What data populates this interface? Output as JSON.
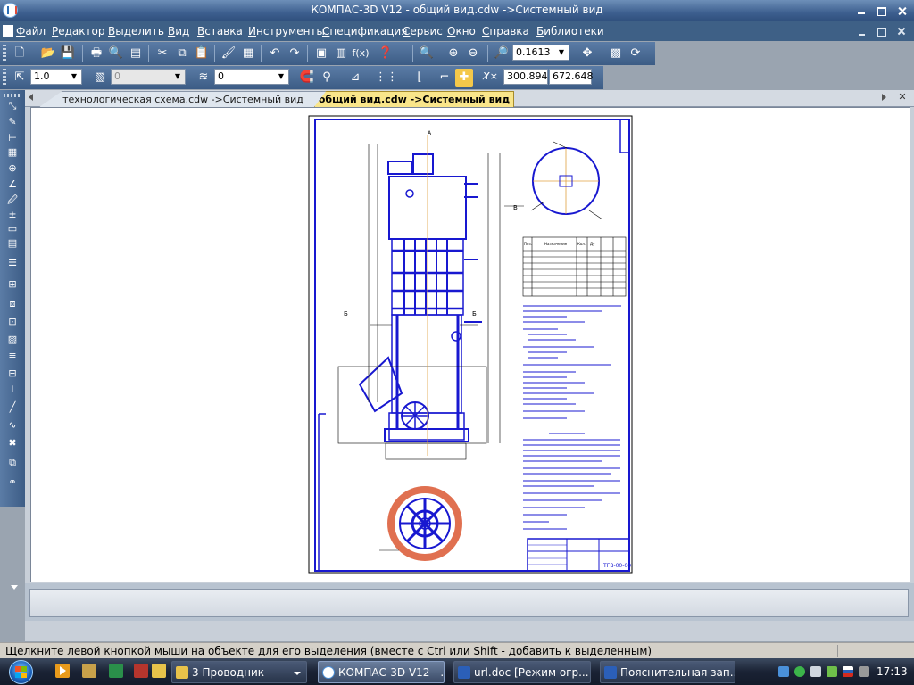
{
  "window": {
    "title": "КОМПАС-3D V12 - общий вид.cdw ->Системный вид"
  },
  "menu": [
    "Файл",
    "Редактор",
    "Выделить",
    "Вид",
    "Вставка",
    "Инструменты",
    "Спецификация",
    "Сервис",
    "Окно",
    "Справка",
    "Библиотеки"
  ],
  "toolbar1": {
    "zoom_value": "0.1613"
  },
  "toolbar2": {
    "line_scale": "1.0",
    "style_value": "0",
    "layer_value": "0",
    "coord_x": "300.894",
    "coord_y": "672.648"
  },
  "tabs": [
    {
      "label": "технологическая схема.cdw ->Системный вид",
      "active": false
    },
    {
      "label": "общий вид.cdw ->Системный вид",
      "active": true
    }
  ],
  "drawing": {
    "table_header": {
      "pos": "Поз.",
      "name": "Назначение",
      "count": "Кол.",
      "dia": "Ду"
    },
    "stamp_code": "ТГВ-00-00",
    "view_label_b": "В",
    "view_label_b2": "Б",
    "section_label": "А"
  },
  "status": {
    "hint": "Щелкните левой кнопкой мыши на объекте для его выделения (вместе с Ctrl или Shift - добавить к выделенным)"
  },
  "taskbar": {
    "items": [
      {
        "label": "3 Проводник",
        "active": false
      },
      {
        "label": "КОМПАС-3D V12 - ...",
        "active": true
      },
      {
        "label": "url.doc [Режим огр...",
        "active": false
      },
      {
        "label": "Пояснительная зап...",
        "active": false
      }
    ],
    "clock": "17:13"
  },
  "colors": {
    "drawing_blue": "#1818d0",
    "accent_orange": "#e07050",
    "active_tab": "#f9e58a"
  }
}
